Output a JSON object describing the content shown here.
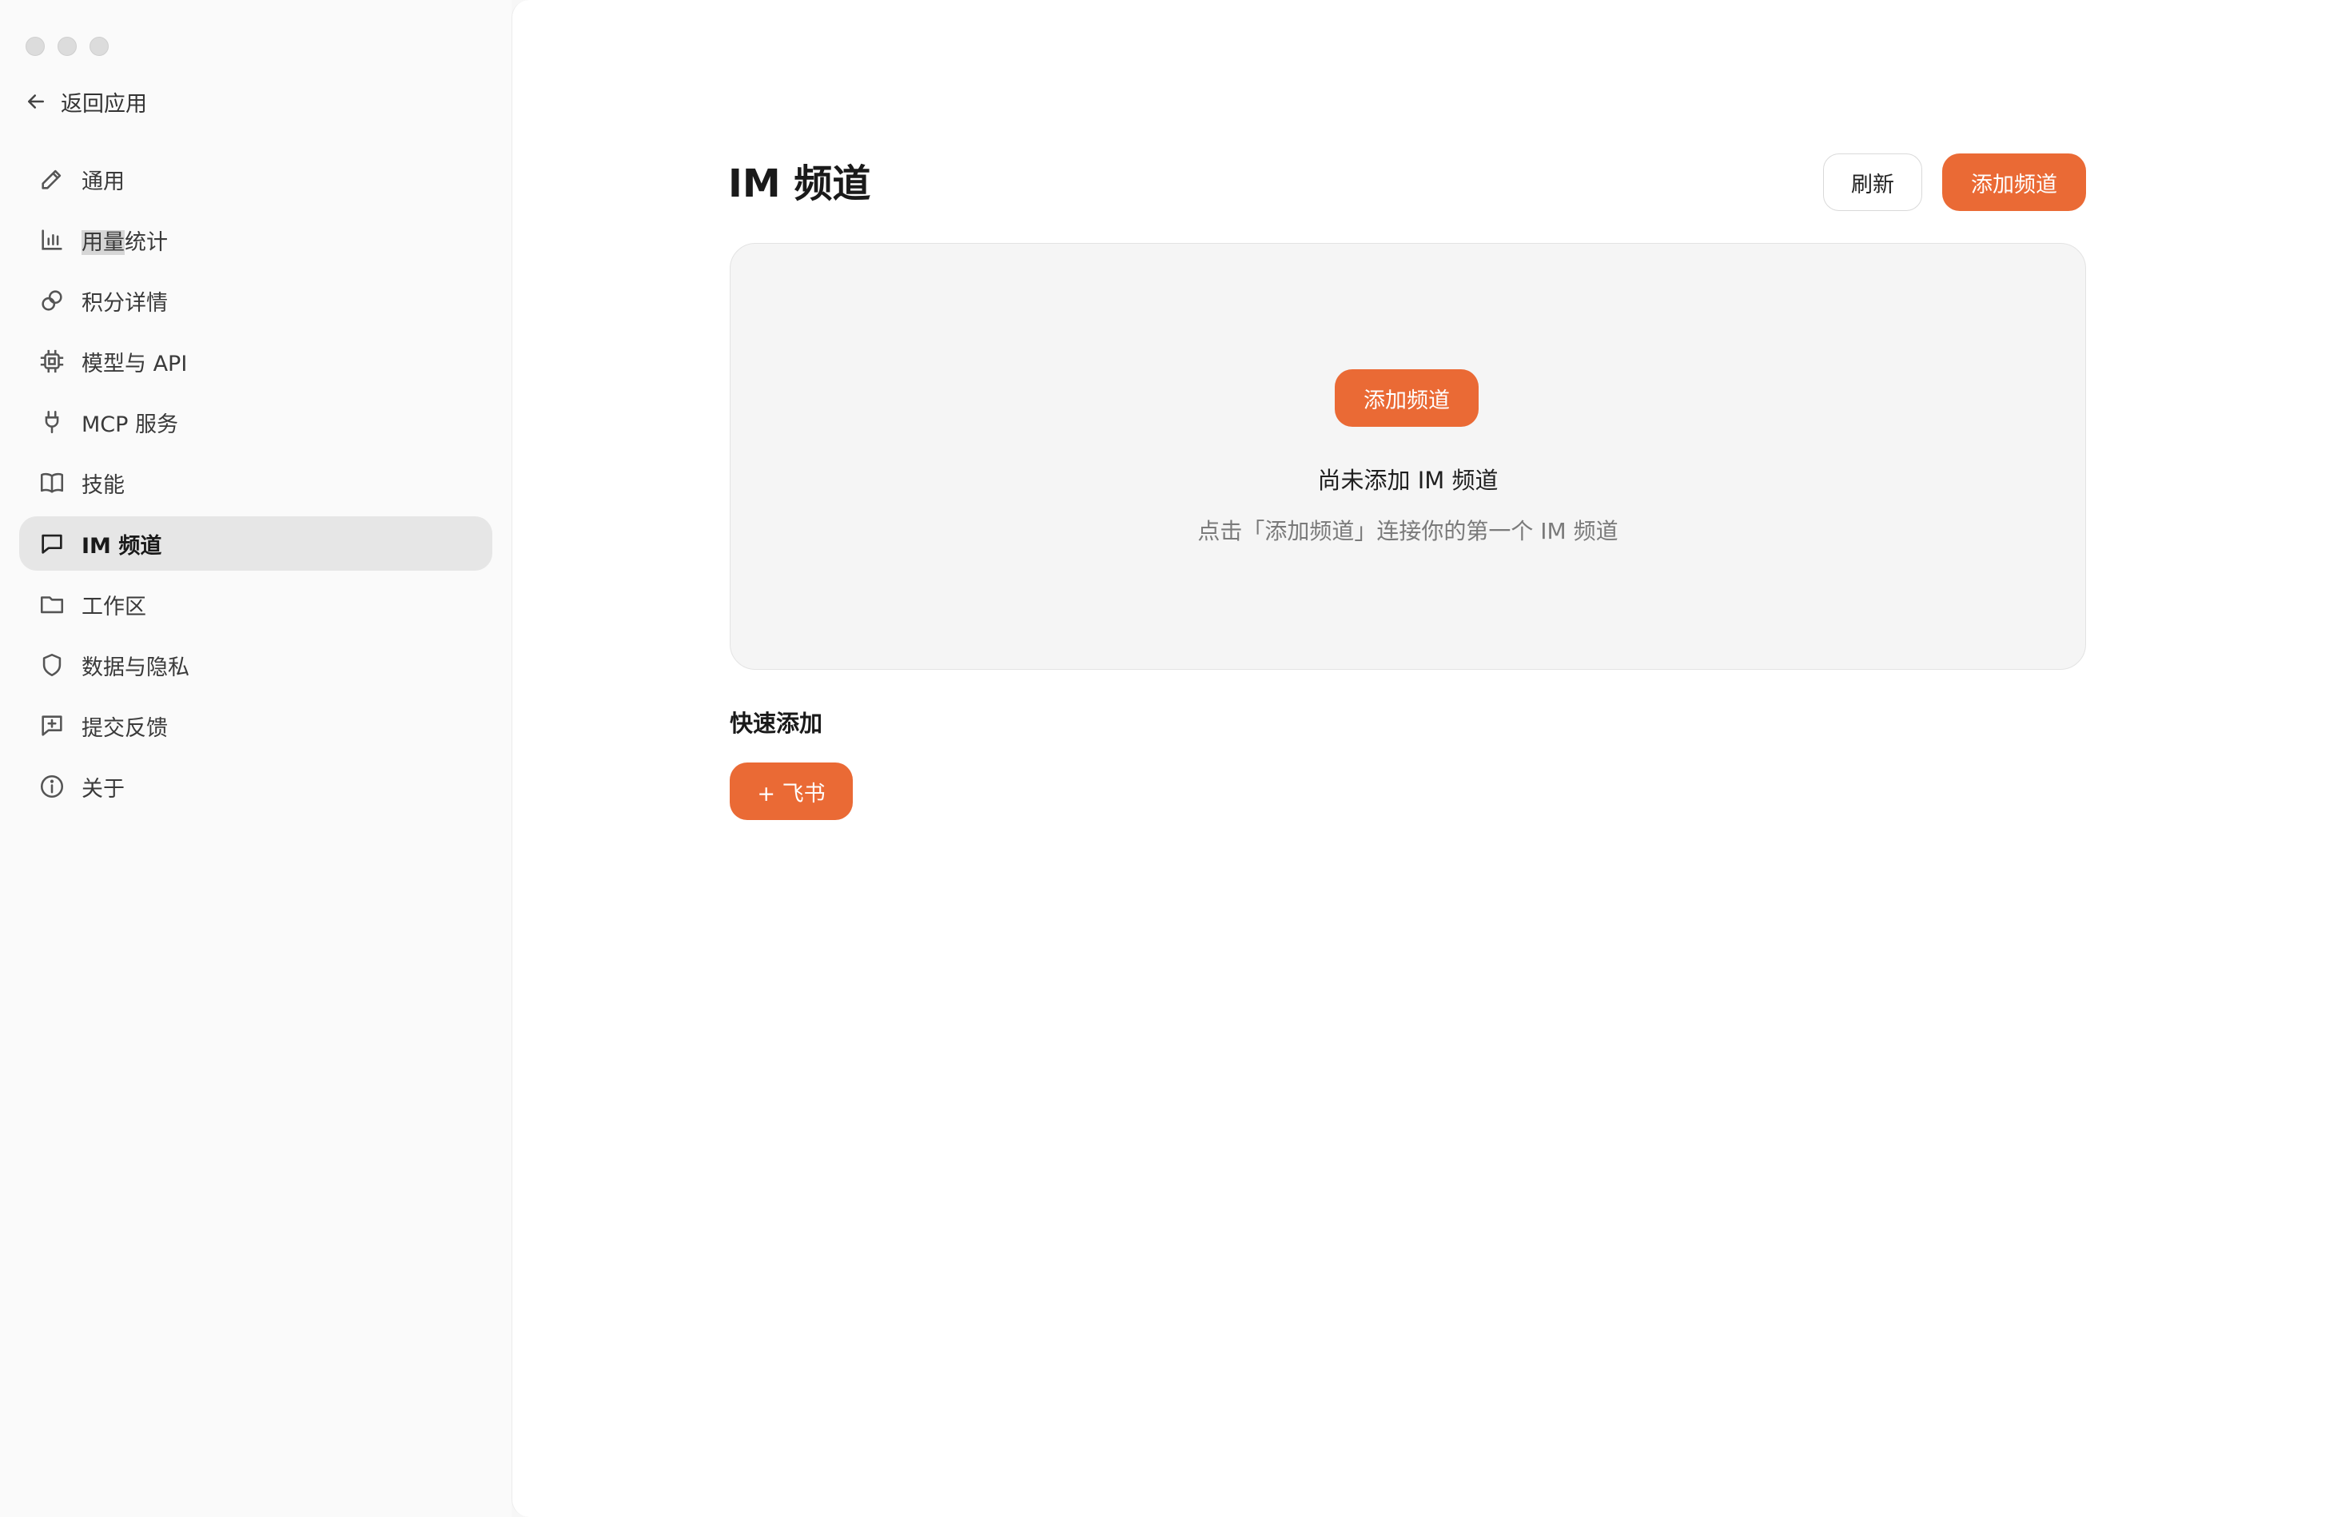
{
  "sidebar": {
    "back_label": "返回应用",
    "items": [
      {
        "label": "通用",
        "icon": "pencil-icon"
      },
      {
        "label_highlight": "用量",
        "label_rest": "统计",
        "icon": "bar-chart-icon"
      },
      {
        "label": "积分详情",
        "icon": "coins-icon"
      },
      {
        "label": "模型与 API",
        "icon": "chip-icon"
      },
      {
        "label": "MCP 服务",
        "icon": "plug-icon"
      },
      {
        "label": "技能",
        "icon": "book-icon"
      },
      {
        "label": "IM 频道",
        "icon": "message-icon",
        "active": true
      },
      {
        "label": "工作区",
        "icon": "folder-icon"
      },
      {
        "label": "数据与隐私",
        "icon": "shield-icon"
      },
      {
        "label": "提交反馈",
        "icon": "feedback-icon"
      },
      {
        "label": "关于",
        "icon": "info-icon"
      }
    ]
  },
  "main": {
    "title": "IM 频道",
    "refresh_label": "刷新",
    "add_channel_label": "添加频道",
    "empty_state": {
      "button_label": "添加频道",
      "title": "尚未添加 IM 频道",
      "hint": "点击「添加频道」连接你的第一个 IM 频道"
    },
    "quick_add": {
      "title": "快速添加",
      "feishu_label": "+ 飞书"
    }
  },
  "colors": {
    "accent": "#ea6a35",
    "sidebar_active": "#e6e6e6"
  }
}
